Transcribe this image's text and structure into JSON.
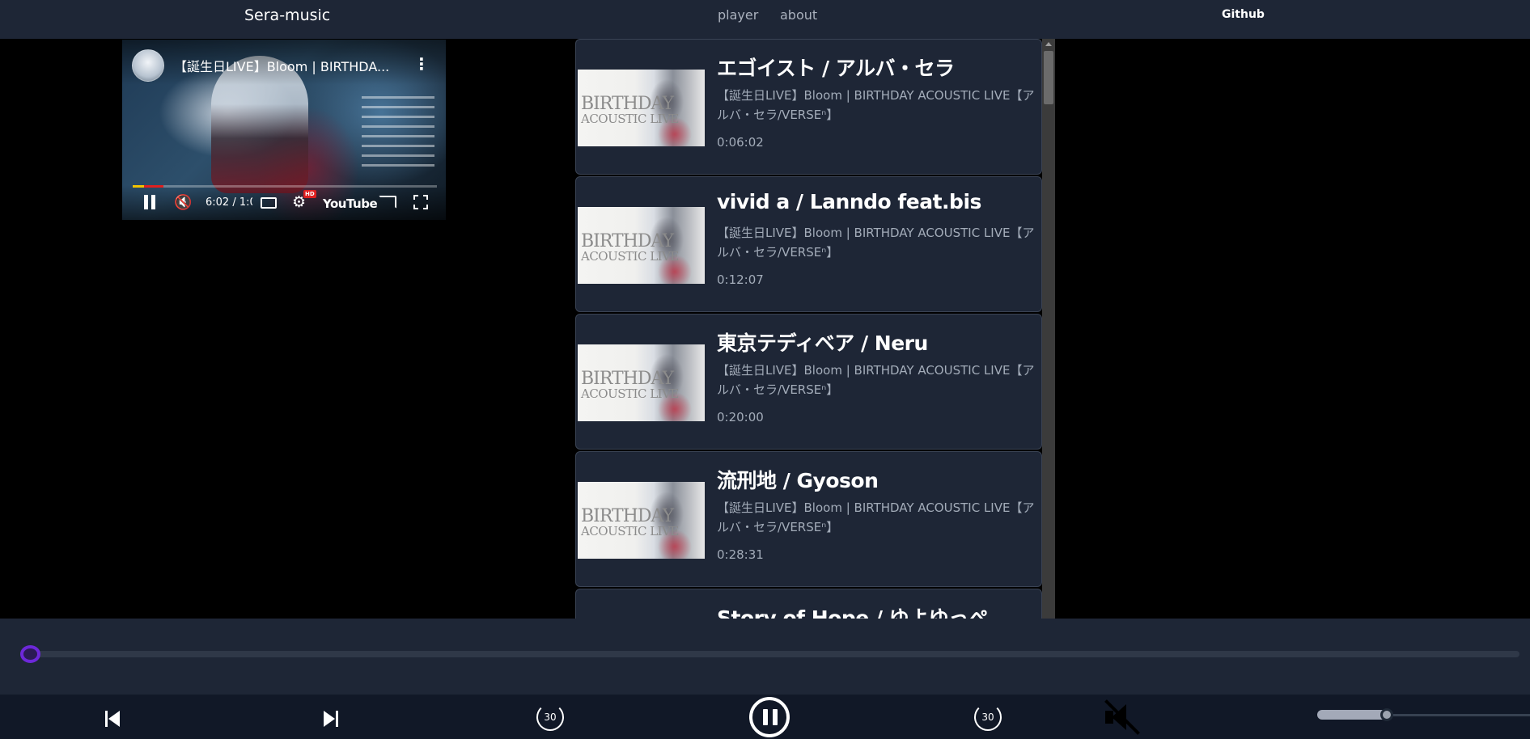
{
  "nav": {
    "brand": "Sera-music",
    "links": [
      "player",
      "about"
    ],
    "github": "Github"
  },
  "video": {
    "title": "【誕生日LIVE】Bloom | BIRTHDA...",
    "time": "6:02 / 1:0(",
    "hd_badge": "HD",
    "youtube_label": "YouTube",
    "progress": 0.1
  },
  "playlist": {
    "thumb_text_1": "BIRTHDAY",
    "thumb_text_2": "ACOUSTIC LIVE",
    "items": [
      {
        "title": "エゴイスト / アルバ・セラ",
        "desc": "【誕生日LIVE】Bloom | BIRTHDAY ACOUSTIC LIVE【アルバ・セラ/VERSEⁿ】",
        "time": "0:06:02"
      },
      {
        "title": "vivid a / Lanndo feat.bis",
        "desc": "【誕生日LIVE】Bloom | BIRTHDAY ACOUSTIC LIVE【アルバ・セラ/VERSEⁿ】",
        "time": "0:12:07"
      },
      {
        "title": "東京テディベア / Neru",
        "desc": "【誕生日LIVE】Bloom | BIRTHDAY ACOUSTIC LIVE【アルバ・セラ/VERSEⁿ】",
        "time": "0:20:00"
      },
      {
        "title": "流刑地 / Gyoson",
        "desc": "【誕生日LIVE】Bloom | BIRTHDAY ACOUSTIC LIVE【アルバ・セラ/VERSEⁿ】",
        "time": "0:28:31"
      },
      {
        "title": "Story of Hope / ゆよゆっぺ",
        "desc": "",
        "time": ""
      }
    ]
  },
  "player": {
    "seek_position": 0.0,
    "skip_back_label": "30",
    "skip_forward_label": "30",
    "volume": 0.33,
    "accent_color": "#6d28d9"
  }
}
